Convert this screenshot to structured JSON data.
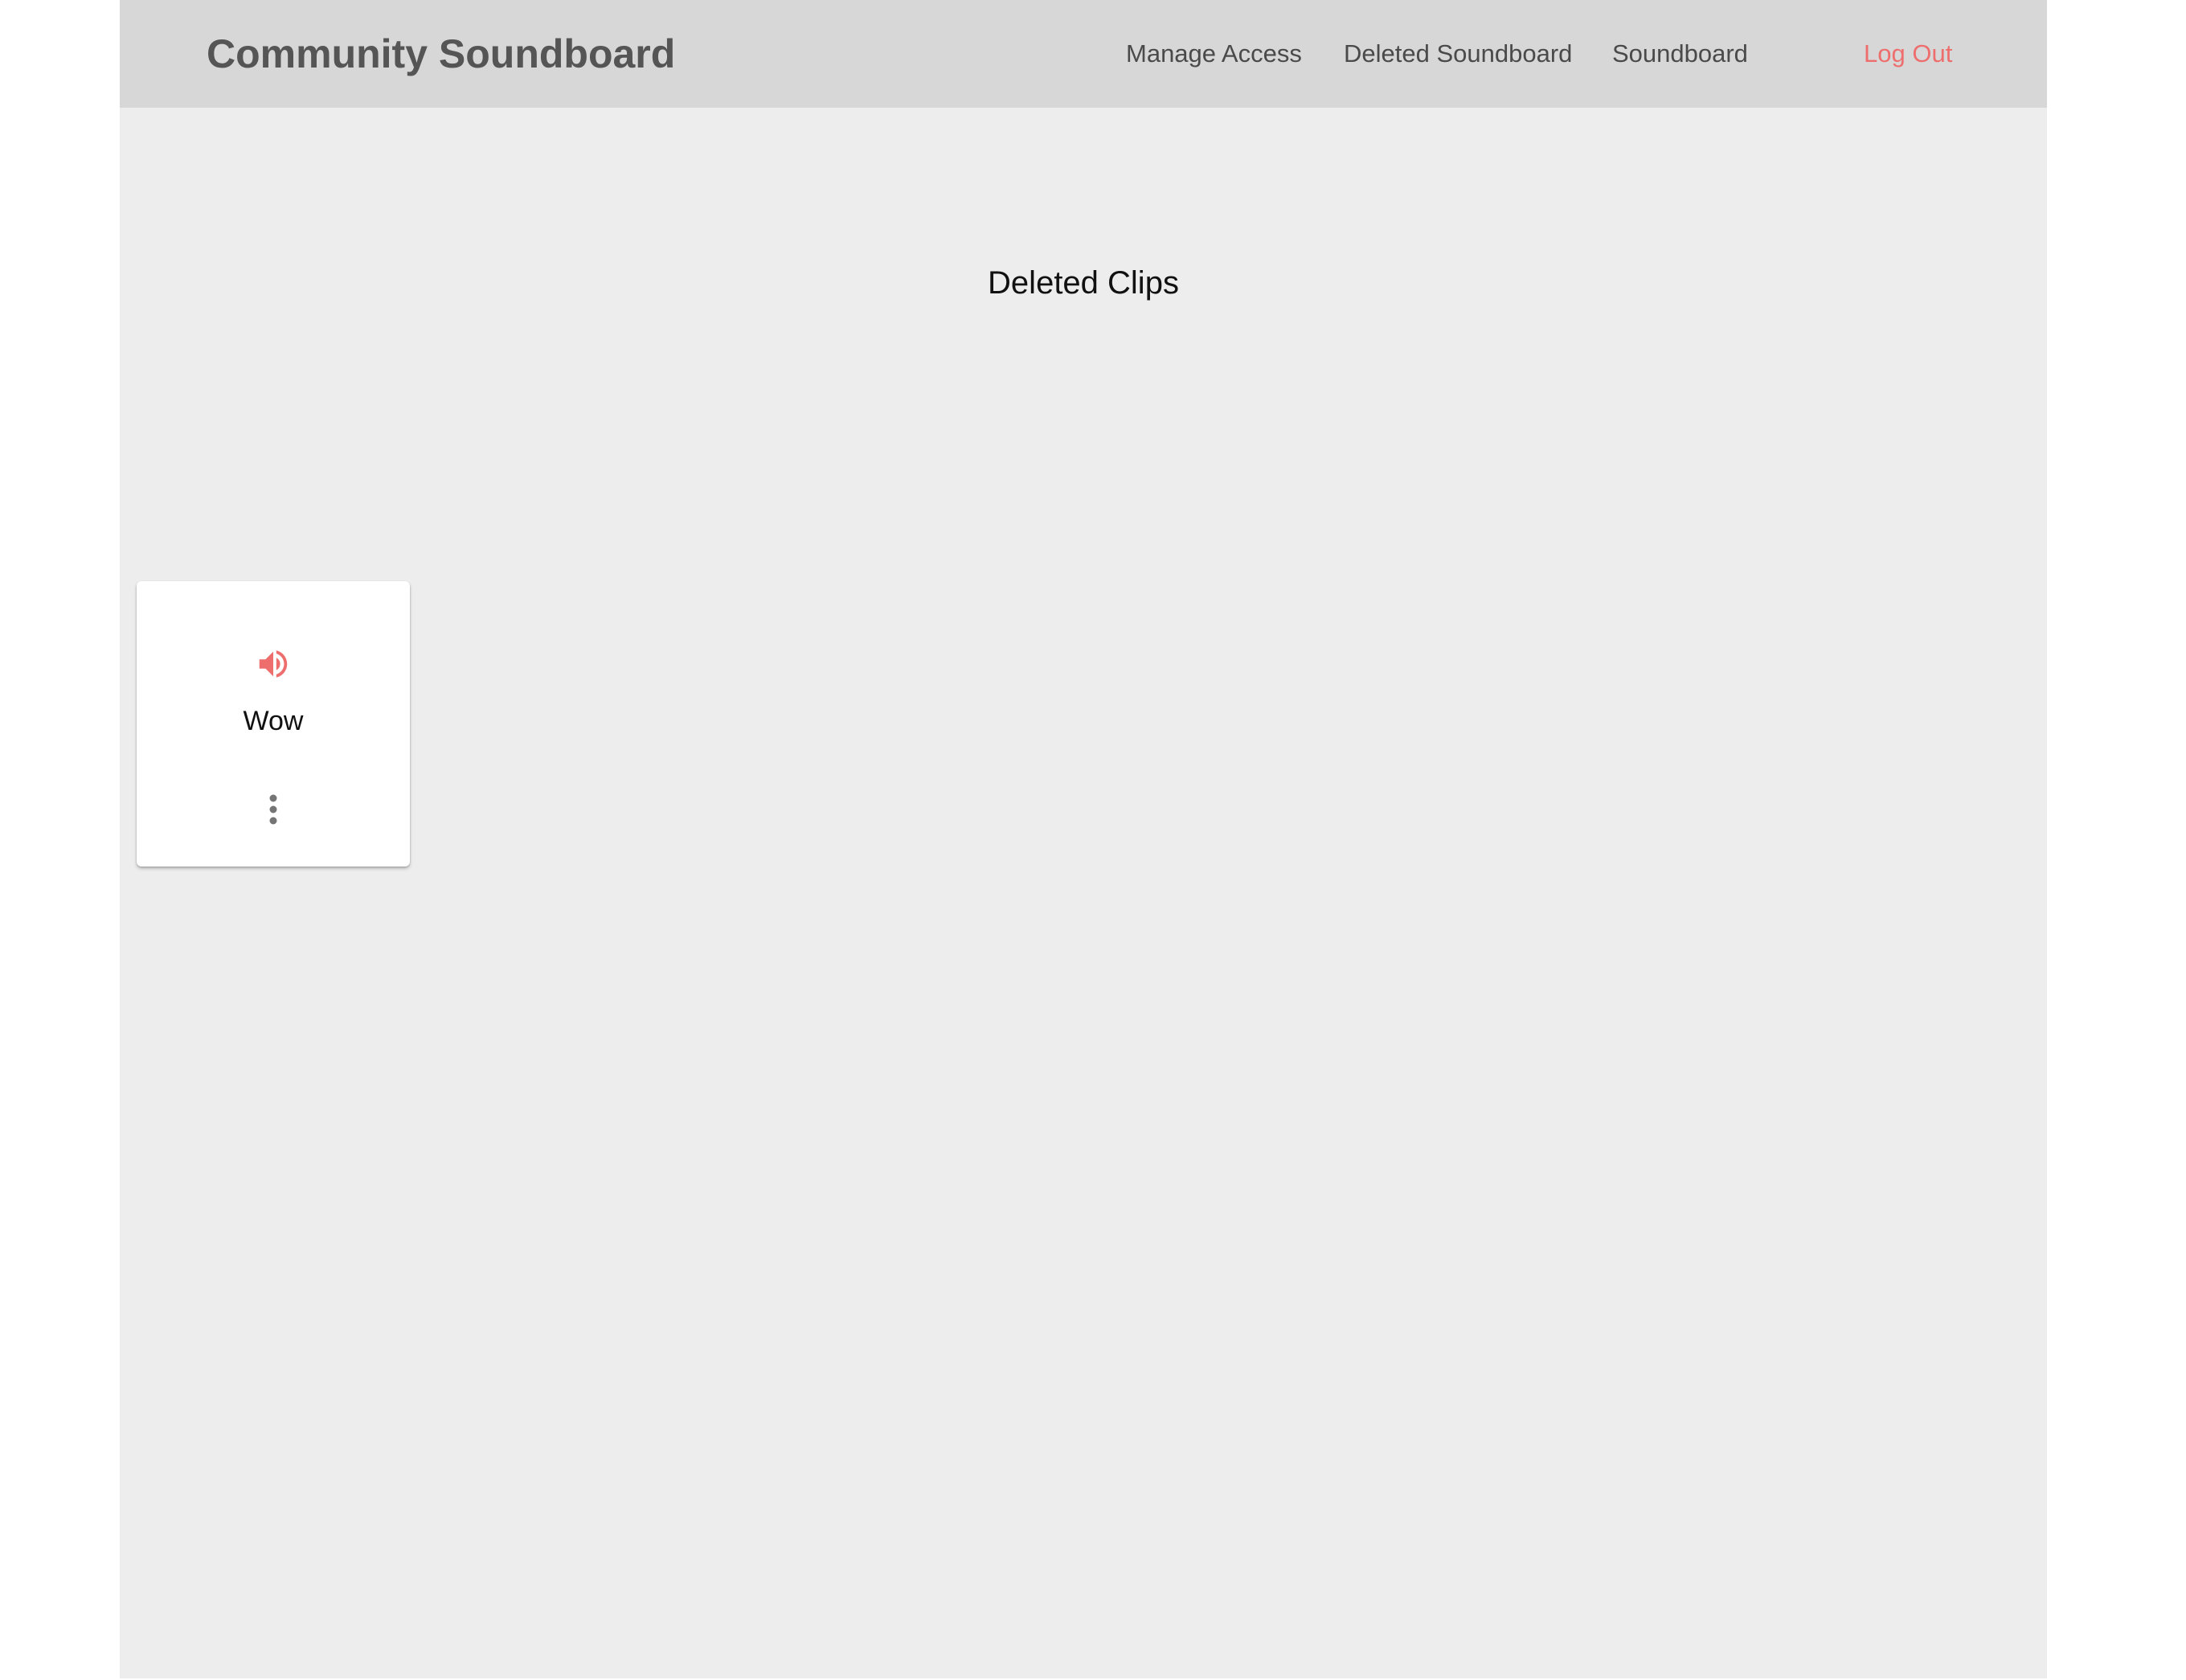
{
  "header": {
    "brand": "Community Soundboard",
    "nav": [
      {
        "label": "Manage Access"
      },
      {
        "label": "Deleted Soundboard"
      },
      {
        "label": "Soundboard"
      }
    ],
    "logout_label": "Log Out"
  },
  "main": {
    "title": "Deleted Clips",
    "clips": [
      {
        "name": "Wow",
        "icon": "volume-up-icon",
        "menu_icon": "more-vert-icon"
      }
    ]
  },
  "colors": {
    "navbar_bg": "#d7d7d7",
    "page_bg": "#ededed",
    "accent": "#ee6e6e",
    "brand_text": "#555555"
  }
}
